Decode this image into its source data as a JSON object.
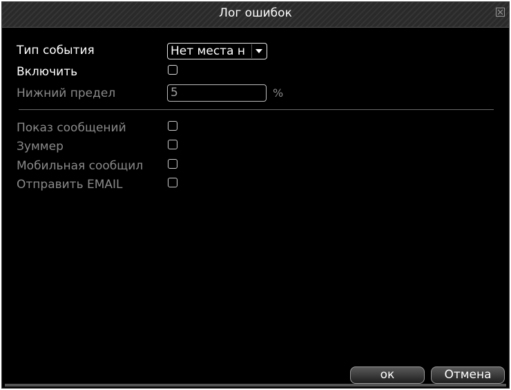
{
  "window": {
    "title": "Лог ошибок",
    "close_icon": "close-icon"
  },
  "form": {
    "event_type": {
      "label": "Тип события",
      "value": "Нет места н"
    },
    "enable": {
      "label": "Включить",
      "checked": false
    },
    "lower_limit": {
      "label": "Нижний предел",
      "value": "5",
      "unit": "%"
    },
    "show_message": {
      "label": "Показ сообщений",
      "checked": false
    },
    "buzzer": {
      "label": "Зуммер",
      "checked": false
    },
    "mobile_message": {
      "label": "Мобильная сообщил",
      "checked": false
    },
    "send_email": {
      "label": "Отправить EMAIL",
      "checked": false
    }
  },
  "buttons": {
    "ok": "ок",
    "cancel": "Отмена"
  },
  "colors": {
    "background": "#000000",
    "active_text": "#ffffff",
    "disabled_text": "#8a8a8a"
  }
}
